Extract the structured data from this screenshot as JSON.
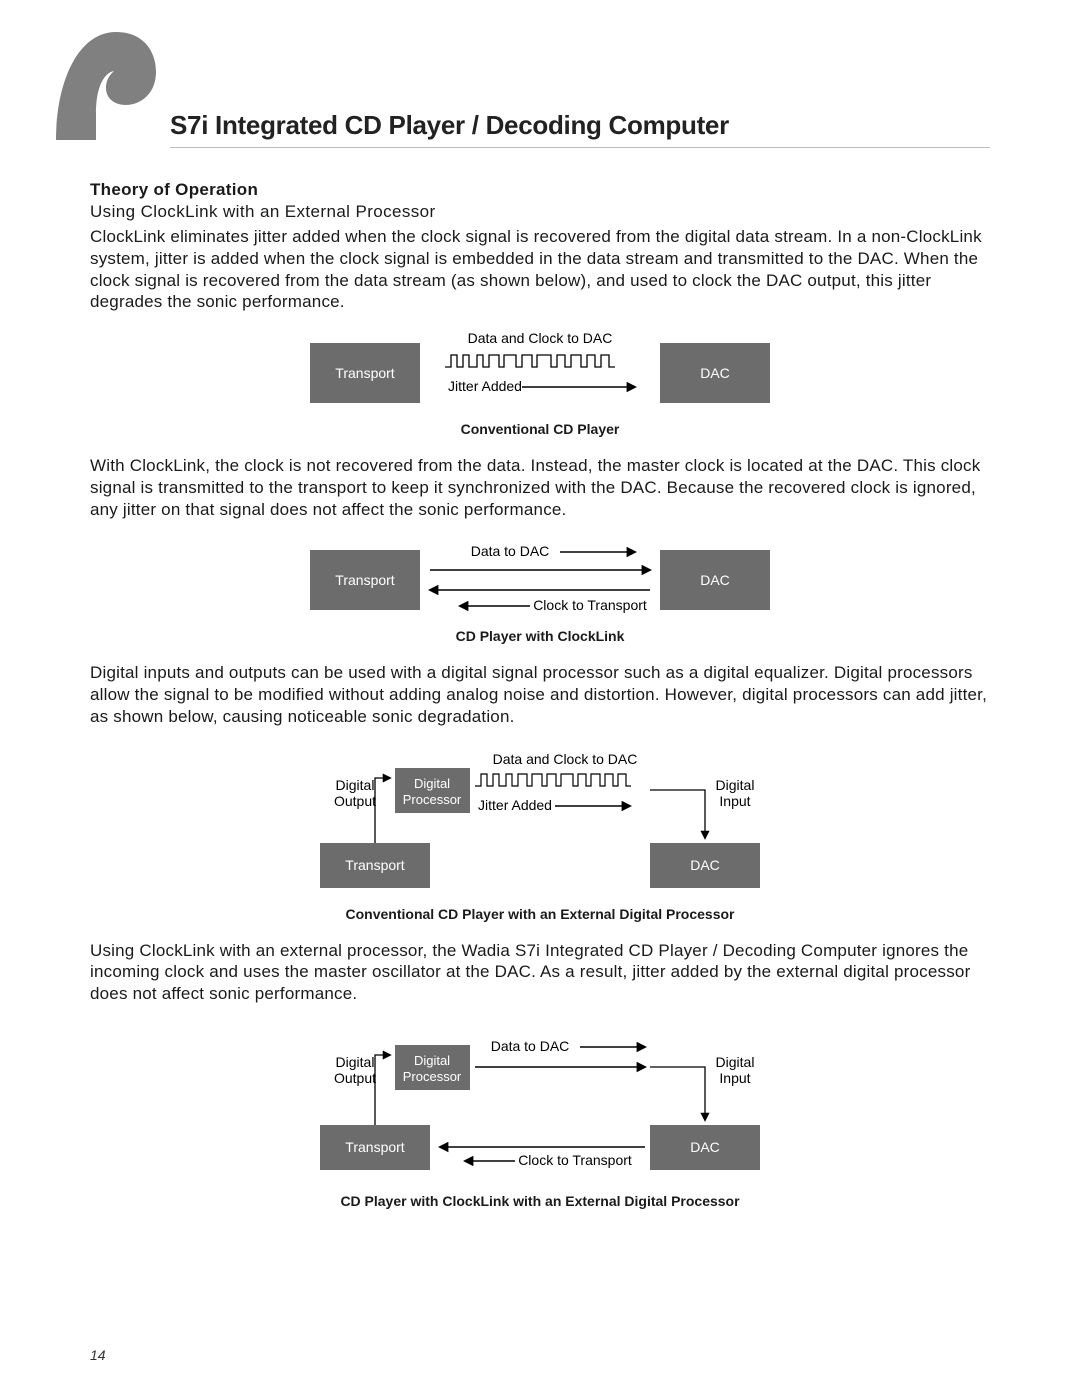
{
  "doc_title": "S7i Integrated CD Player / Decoding Computer",
  "section_heading": "Theory of Operation",
  "subheading": "Using ClockLink with an External Processor",
  "para1": "ClockLink eliminates jitter added when the clock signal is recovered from the digital data stream. In a non-ClockLink system, jitter is added when the clock signal is embedded in the data stream and transmitted to the DAC. When the clock signal is recovered from the data stream (as shown below), and used to clock the DAC output, this jitter degrades the sonic performance.",
  "para2": "With ClockLink, the clock is not recovered from the data. Instead, the master clock is located at the DAC. This clock signal is transmitted to the transport to keep it synchronized with the DAC. Because the recovered clock is ignored, any jitter on that signal does not affect the sonic performance.",
  "para3": "Digital inputs and outputs can be used with a digital signal processor such as a digital equalizer. Digital processors allow the signal to be modified without adding analog noise and distortion. However, digital processors can add jitter, as shown below, causing noticeable sonic degradation.",
  "para4": "Using ClockLink with an external processor, the Wadia S7i Integrated CD Player / Decoding Computer ignores the incoming clock and uses the master oscillator at the DAC. As a result, jitter added by the external digital processor does not affect sonic performance.",
  "diagram1": {
    "transport": "Transport",
    "dac": "DAC",
    "top_label": "Data and Clock to DAC",
    "jitter": "Jitter Added",
    "caption": "Conventional CD Player"
  },
  "diagram2": {
    "transport": "Transport",
    "dac": "DAC",
    "top_label": "Data to DAC",
    "bottom_label": "Clock to Transport",
    "caption": "CD Player with ClockLink"
  },
  "diagram3": {
    "transport": "Transport",
    "dac": "DAC",
    "dp_line1": "Digital",
    "dp_line2": "Processor",
    "digital_output": "Digital\nOutput",
    "digital_input": "Digital\nInput",
    "top_label": "Data and Clock to DAC",
    "jitter": "Jitter Added",
    "caption": "Conventional CD Player with an External Digital Processor"
  },
  "diagram4": {
    "transport": "Transport",
    "dac": "DAC",
    "dp_line1": "Digital",
    "dp_line2": "Processor",
    "digital_output": "Digital\nOutput",
    "digital_input": "Digital\nInput",
    "top_label": "Data to DAC",
    "bottom_label": "Clock to Transport",
    "caption": "CD Player with ClockLink with an External Digital Processor"
  },
  "page_number": "14"
}
